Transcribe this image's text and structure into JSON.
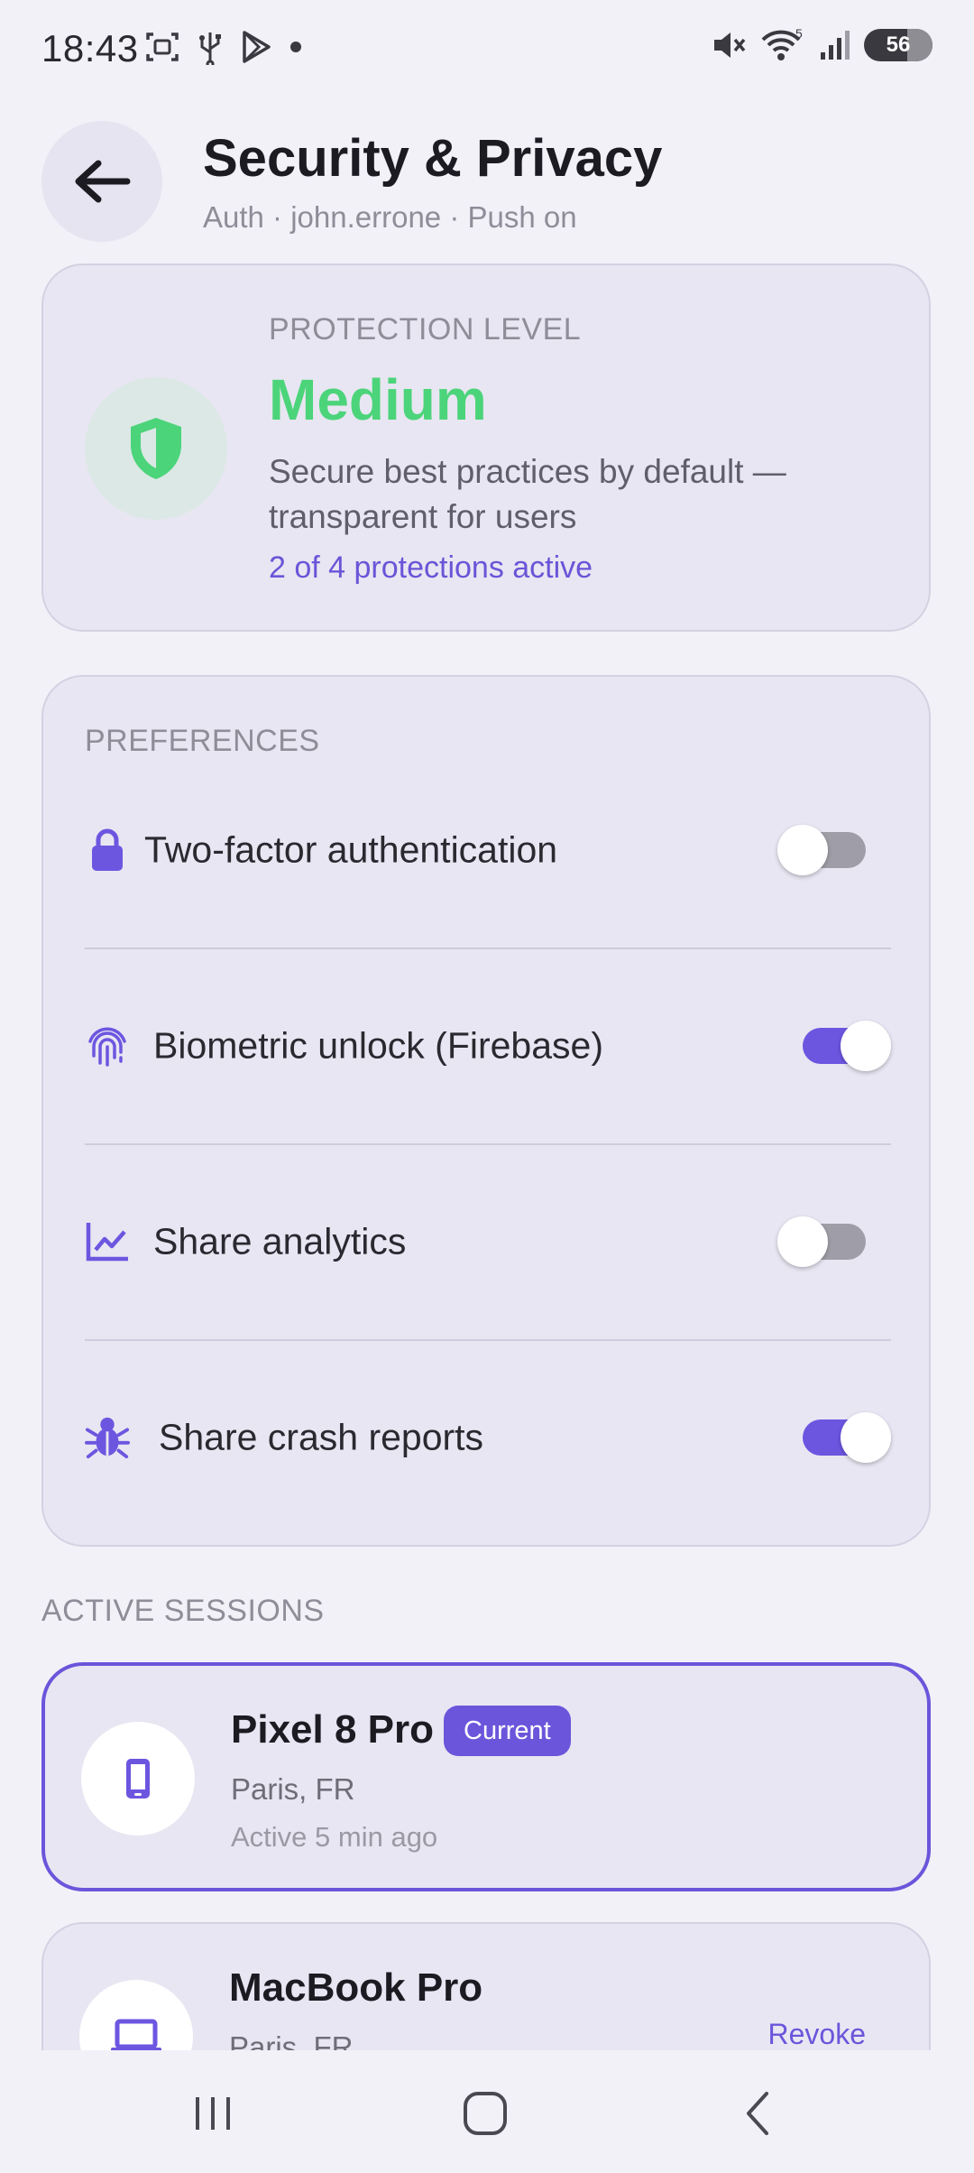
{
  "status_bar": {
    "time": "18:43",
    "battery": "56",
    "left_icons": [
      "screenshot-icon",
      "usb-icon",
      "play-store-icon",
      "dot-icon"
    ],
    "right_icons": [
      "mute-icon",
      "wifi-icon",
      "signal-icon",
      "battery-icon"
    ]
  },
  "header": {
    "title": "Security & Privacy",
    "subtitle": "Auth · john.errone · Push on"
  },
  "protection": {
    "label": "PROTECTION LEVEL",
    "level": "Medium",
    "description": "Secure best practices by default — transparent for users",
    "active_count": "2 of 4 protections active",
    "accent_color": "#4CD47A"
  },
  "preferences": {
    "label": "PREFERENCES",
    "items": [
      {
        "label": "Two-factor authentication",
        "icon": "lock-icon",
        "enabled": false
      },
      {
        "label": "Biometric unlock (Firebase)",
        "icon": "fingerprint-icon",
        "enabled": true
      },
      {
        "label": "Share analytics",
        "icon": "chart-icon",
        "enabled": false
      },
      {
        "label": "Share crash reports",
        "icon": "bug-icon",
        "enabled": true
      }
    ]
  },
  "sessions": {
    "label": "ACTIVE SESSIONS",
    "items": [
      {
        "device": "Pixel 8 Pro",
        "badge": "Current",
        "location": "Paris, FR",
        "active": "Active 5 min ago",
        "icon": "phone-icon"
      },
      {
        "device": "MacBook Pro",
        "location": "Paris, FR",
        "action": "Revoke",
        "icon": "laptop-icon"
      }
    ]
  },
  "colors": {
    "accent": "#6B55DB",
    "success": "#4CD47A",
    "background": "#F2F1F8"
  }
}
